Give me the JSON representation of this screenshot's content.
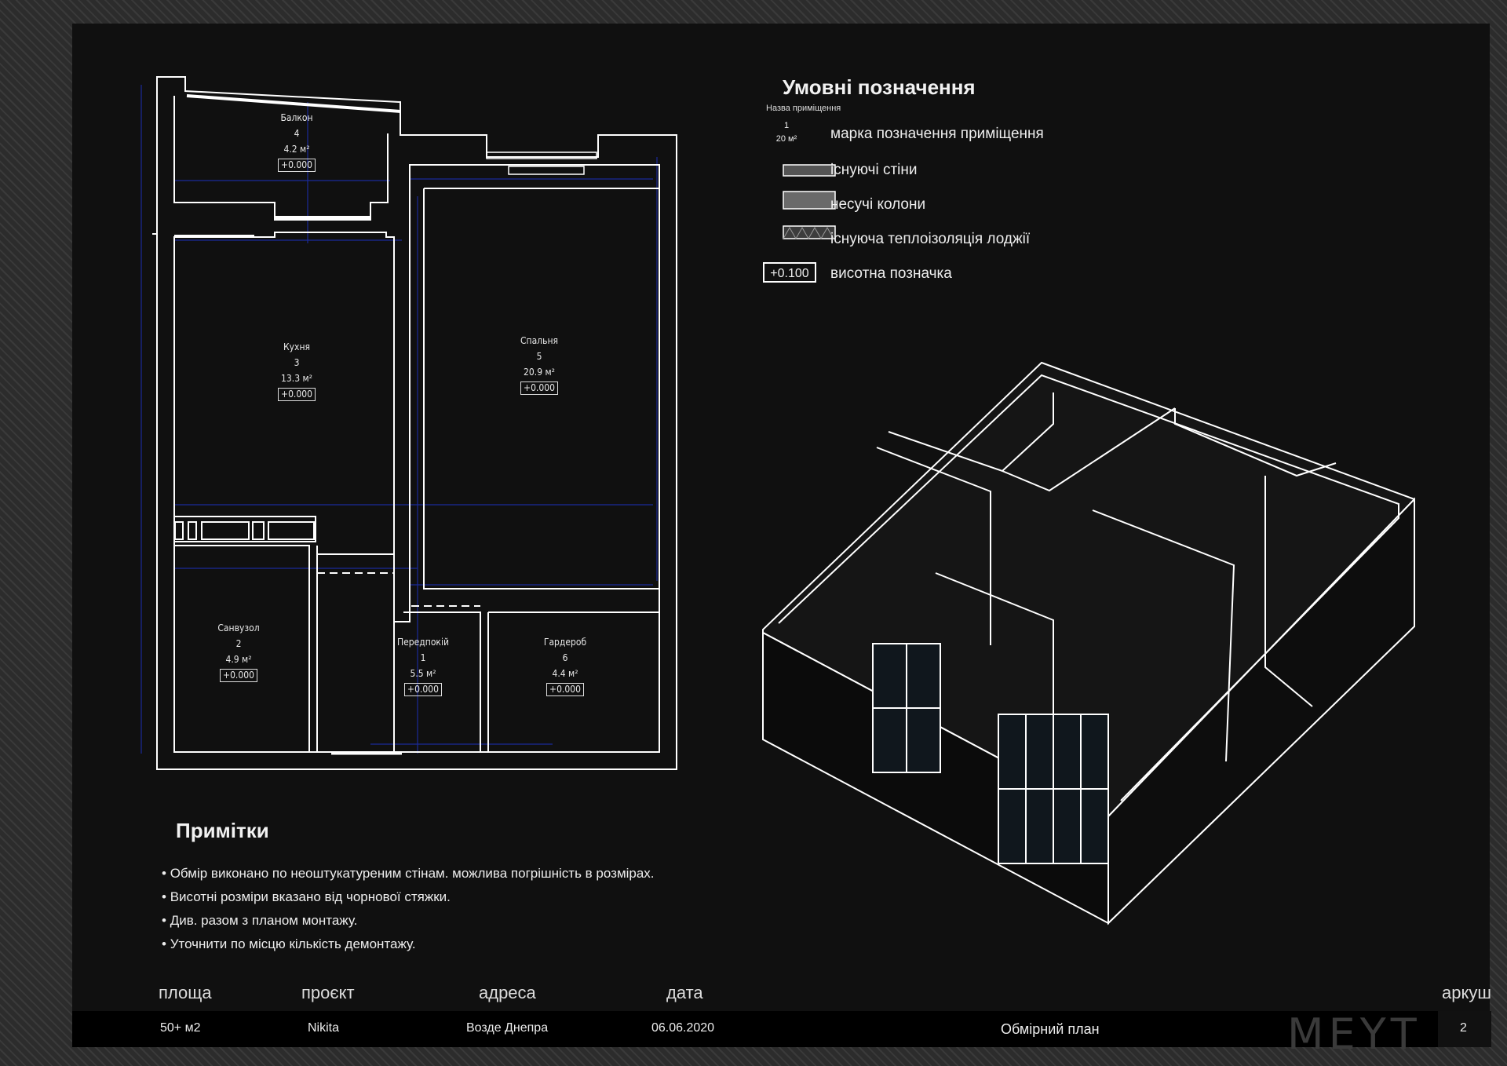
{
  "rooms": [
    {
      "name": "Балкон",
      "number": "4",
      "area": "4.2 м²",
      "elevation": "+0.000"
    },
    {
      "name": "Кухня",
      "number": "3",
      "area": "13.3 м²",
      "elevation": "+0.000"
    },
    {
      "name": "Спальня",
      "number": "5",
      "area": "20.9 м²",
      "elevation": "+0.000"
    },
    {
      "name": "Санвузол",
      "number": "2",
      "area": "4.9 м²",
      "elevation": "+0.000"
    },
    {
      "name": "Передпокій",
      "number": "1",
      "area": "5.5 м²",
      "elevation": "+0.000"
    },
    {
      "name": "Гардероб",
      "number": "6",
      "area": "4.4 м²",
      "elevation": "+0.000"
    }
  ],
  "legend": {
    "title": "Умовні позначення",
    "subtitle": "Назва приміщення",
    "sample_number": "1",
    "sample_area": "20 м²",
    "sample_elevation": "+0.100",
    "items": [
      {
        "label": "марка позначення приміщення",
        "icon": "room-tag-icon"
      },
      {
        "label": "існуючі стіни",
        "icon": "wall-hatch-icon"
      },
      {
        "label": "несучі колони",
        "icon": "column-hatch-icon"
      },
      {
        "label": "існуюча теплоізоляція лоджії",
        "icon": "insulation-hatch-icon"
      },
      {
        "label": "висотна позначка",
        "icon": "elevation-mark-icon"
      }
    ]
  },
  "notes": {
    "title": "Примітки",
    "items": [
      "Обмір виконано по неоштукатуреним стінам. можлива погрішність в розмірах.",
      "Висотні розміри вказано від чорнової стяжки.",
      "Див. разом з планом монтажу.",
      "Уточнити по місцю кількість демонтажу."
    ]
  },
  "footer": {
    "labels": {
      "area": "площа",
      "project": "проєкт",
      "address": "адреса",
      "date": "дата",
      "sheet": "аркуш"
    },
    "values": {
      "area": "50+ м2",
      "project": "Nikita",
      "address": "Возде Днепра",
      "date": "06.06.2020",
      "title": "Обмірний план",
      "sheet": "2"
    },
    "brand": "MEYT"
  },
  "colors": {
    "background": "#101010",
    "line": "#ffffff",
    "dimension": "#1b2a9a",
    "accent": "#eeeeee"
  }
}
